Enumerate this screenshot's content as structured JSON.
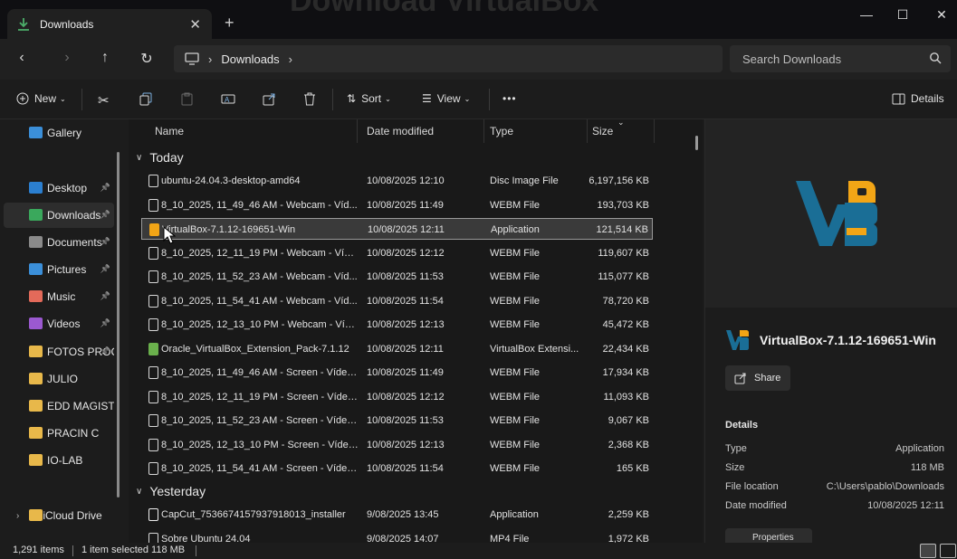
{
  "background_title": "Download VirtualBox",
  "tab": {
    "label": "Downloads",
    "close": "✕",
    "new": "+"
  },
  "window": {
    "minimize": "—",
    "maximize": "☐",
    "close": "✕"
  },
  "address": {
    "location": "Downloads",
    "search_placeholder": "Search Downloads"
  },
  "commands": {
    "new": "New",
    "sort": "Sort",
    "view": "View",
    "more": "•••",
    "details": "Details"
  },
  "sidebar": {
    "items": [
      {
        "label": "Gallery",
        "color": "#3b8fd9",
        "pinned": false
      },
      {
        "label": "Desktop",
        "color": "#2b7fd0",
        "pinned": true
      },
      {
        "label": "Downloads",
        "color": "#3aa85c",
        "pinned": true
      },
      {
        "label": "Documents",
        "color": "#8a8a8a",
        "pinned": true
      },
      {
        "label": "Pictures",
        "color": "#3b8fd9",
        "pinned": true
      },
      {
        "label": "Music",
        "color": "#e36a5a",
        "pinned": true
      },
      {
        "label": "Videos",
        "color": "#9b59d0",
        "pinned": true
      },
      {
        "label": "FOTOS PROC",
        "color": "#e8b84a",
        "pinned": true
      },
      {
        "label": "JULIO",
        "color": "#e8b84a",
        "pinned": false
      },
      {
        "label": "EDD MAGISTR",
        "color": "#e8b84a",
        "pinned": false
      },
      {
        "label": "PRACIN C",
        "color": "#e8b84a",
        "pinned": false
      },
      {
        "label": "IO-LAB",
        "color": "#e8b84a",
        "pinned": false
      },
      {
        "label": "iCloud Drive",
        "color": "#e8b84a",
        "pinned": false
      }
    ]
  },
  "columns": {
    "name": "Name",
    "date": "Date modified",
    "type": "Type",
    "size": "Size"
  },
  "groups": {
    "today": "Today",
    "yesterday": "Yesterday"
  },
  "files_today": [
    {
      "name": "ubuntu-24.04.3-desktop-amd64",
      "date": "10/08/2025 12:10",
      "type": "Disc Image File",
      "size": "6,197,156 KB",
      "icon": "disc-file-icon"
    },
    {
      "name": "8_10_2025, 11_49_46 AM - Webcam - Víd...",
      "date": "10/08/2025 11:49",
      "type": "WEBM File",
      "size": "193,703 KB",
      "icon": "video-file-icon"
    },
    {
      "name": "VirtualBox-7.1.12-169651-Win",
      "date": "10/08/2025 12:11",
      "type": "Application",
      "size": "121,514 KB",
      "icon": "virtualbox-app-icon"
    },
    {
      "name": "8_10_2025, 12_11_19 PM - Webcam - Víde...",
      "date": "10/08/2025 12:12",
      "type": "WEBM File",
      "size": "119,607 KB",
      "icon": "video-file-icon"
    },
    {
      "name": "8_10_2025, 11_52_23 AM - Webcam - Víd...",
      "date": "10/08/2025 11:53",
      "type": "WEBM File",
      "size": "115,077 KB",
      "icon": "video-file-icon"
    },
    {
      "name": "8_10_2025, 11_54_41 AM - Webcam - Víd...",
      "date": "10/08/2025 11:54",
      "type": "WEBM File",
      "size": "78,720 KB",
      "icon": "video-file-icon"
    },
    {
      "name": "8_10_2025, 12_13_10 PM - Webcam - Víde...",
      "date": "10/08/2025 12:13",
      "type": "WEBM File",
      "size": "45,472 KB",
      "icon": "video-file-icon"
    },
    {
      "name": "Oracle_VirtualBox_Extension_Pack-7.1.12",
      "date": "10/08/2025 12:11",
      "type": "VirtualBox Extensi...",
      "size": "22,434 KB",
      "icon": "extension-pack-icon"
    },
    {
      "name": "8_10_2025, 11_49_46 AM - Screen - Vídeo ...",
      "date": "10/08/2025 11:49",
      "type": "WEBM File",
      "size": "17,934 KB",
      "icon": "video-file-icon"
    },
    {
      "name": "8_10_2025, 12_11_19 PM - Screen - Vídeo ...",
      "date": "10/08/2025 12:12",
      "type": "WEBM File",
      "size": "11,093 KB",
      "icon": "video-file-icon"
    },
    {
      "name": "8_10_2025, 11_52_23 AM - Screen - Vídeo ...",
      "date": "10/08/2025 11:53",
      "type": "WEBM File",
      "size": "9,067 KB",
      "icon": "video-file-icon"
    },
    {
      "name": "8_10_2025, 12_13_10 PM - Screen - Vídeo ...",
      "date": "10/08/2025 12:13",
      "type": "WEBM File",
      "size": "2,368 KB",
      "icon": "video-file-icon"
    },
    {
      "name": "8_10_2025, 11_54_41 AM - Screen - Vídeo ...",
      "date": "10/08/2025 11:54",
      "type": "WEBM File",
      "size": "165 KB",
      "icon": "video-file-icon"
    }
  ],
  "files_yesterday": [
    {
      "name": "CapCut_7536674157937918013_installer",
      "date": "9/08/2025 13:45",
      "type": "Application",
      "size": "2,259 KB",
      "icon": "capcut-app-icon"
    },
    {
      "name": "Sobre Ubuntu 24.04",
      "date": "9/08/2025 14:07",
      "type": "MP4 File",
      "size": "1,972 KB",
      "icon": "video-file-icon"
    }
  ],
  "details": {
    "title": "VirtualBox-7.1.12-169651-Win",
    "share": "Share",
    "section": "Details",
    "properties_button": "Properties",
    "fields": [
      {
        "key": "Type",
        "value": "Application"
      },
      {
        "key": "Size",
        "value": "118 MB"
      },
      {
        "key": "File location",
        "value": "C:\\Users\\pablo\\Downloads"
      },
      {
        "key": "Date modified",
        "value": "10/08/2025 12:11"
      }
    ]
  },
  "status": {
    "items": "1,291 items",
    "selected": "1 item selected  118 MB"
  },
  "colors": {
    "accent": "#1f6fa8",
    "logo_blue": "#1a6e96",
    "logo_orange": "#f2a516"
  }
}
